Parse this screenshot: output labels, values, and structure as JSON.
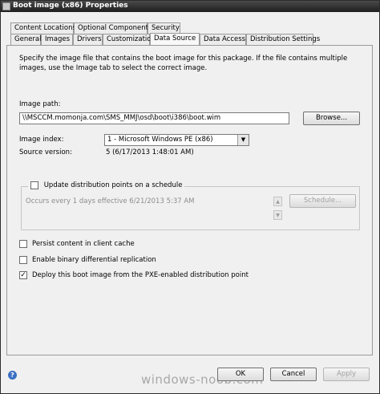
{
  "window": {
    "title": "Boot image (x86) Properties"
  },
  "tabs": {
    "row1": [
      "Content Locations",
      "Optional Components",
      "Security"
    ],
    "row2": [
      "General",
      "Images",
      "Drivers",
      "Customization",
      "Data Source",
      "Data Access",
      "Distribution Settings"
    ],
    "active": "Data Source"
  },
  "description": "Specify the image file that contains the boot image for this package. If the file contains multiple images, use the Image tab to select the correct image.",
  "image_path": {
    "label": "Image path:",
    "value": "\\\\MSCCM.momonja.com\\SMS_MMJ\\osd\\boot\\i386\\boot.wim",
    "browse_label": "Browse..."
  },
  "image_index": {
    "label": "Image index:",
    "selected": "1 - Microsoft Windows PE (x86)"
  },
  "source_version": {
    "label": "Source version:",
    "value": "5 (6/17/2013 1:48:01 AM)"
  },
  "schedule": {
    "checkbox_label": "Update distribution points on a schedule",
    "checked": false,
    "summary": "Occurs every 1 days effective 6/21/2013 5:37 AM",
    "button_label": "Schedule..."
  },
  "options": [
    {
      "label": "Persist content in client cache",
      "checked": false
    },
    {
      "label": "Enable binary differential replication",
      "checked": false
    },
    {
      "label": "Deploy this boot image from the PXE-enabled distribution point",
      "checked": true
    }
  ],
  "footer": {
    "ok": "OK",
    "cancel": "Cancel",
    "apply": "Apply"
  },
  "watermark": "windows-noob.com",
  "icons": {
    "help": "?",
    "check": "✓",
    "dropdown": "▼",
    "spin_up": "▲",
    "spin_down": "▼"
  }
}
